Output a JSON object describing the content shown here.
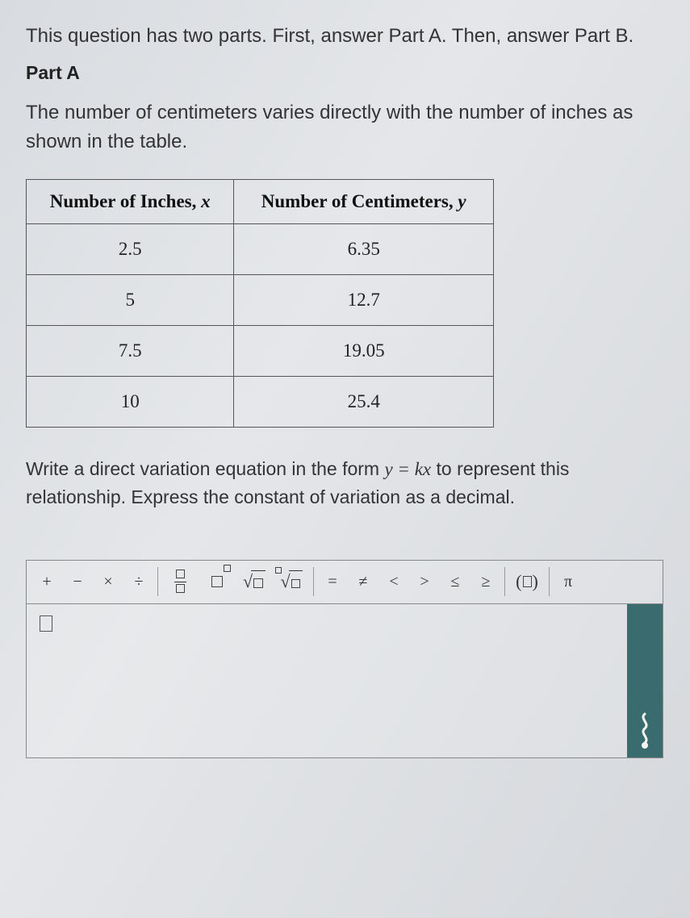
{
  "intro": "This question has two parts. First, answer Part A. Then, answer Part B.",
  "partLabel": "Part A",
  "prompt": "The number of centimeters varies directly with the number of inches as shown in the table.",
  "table": {
    "headers": {
      "col1_text": "Number of Inches, ",
      "col1_var": "x",
      "col2_text": "Number of Centimeters, ",
      "col2_var": "y"
    },
    "rows": [
      {
        "x": "2.5",
        "y": "6.35"
      },
      {
        "x": "5",
        "y": "12.7"
      },
      {
        "x": "7.5",
        "y": "19.05"
      },
      {
        "x": "10",
        "y": "25.4"
      }
    ]
  },
  "instruction_pre": "Write a direct variation equation in the form ",
  "instruction_eq": "y = kx",
  "instruction_post": " to represent this relationship. Express the constant of variation as a decimal.",
  "toolbar": {
    "plus": "+",
    "minus": "−",
    "times": "×",
    "divide": "÷",
    "eq": "=",
    "neq": "≠",
    "lt": "<",
    "gt": ">",
    "le": "≤",
    "ge": "≥",
    "pi": "π",
    "sqrt": "√",
    "nroot": "√"
  },
  "chart_data": {
    "type": "table",
    "columns": [
      "Number of Inches, x",
      "Number of Centimeters, y"
    ],
    "rows": [
      [
        2.5,
        6.35
      ],
      [
        5,
        12.7
      ],
      [
        7.5,
        19.05
      ],
      [
        10,
        25.4
      ]
    ]
  }
}
